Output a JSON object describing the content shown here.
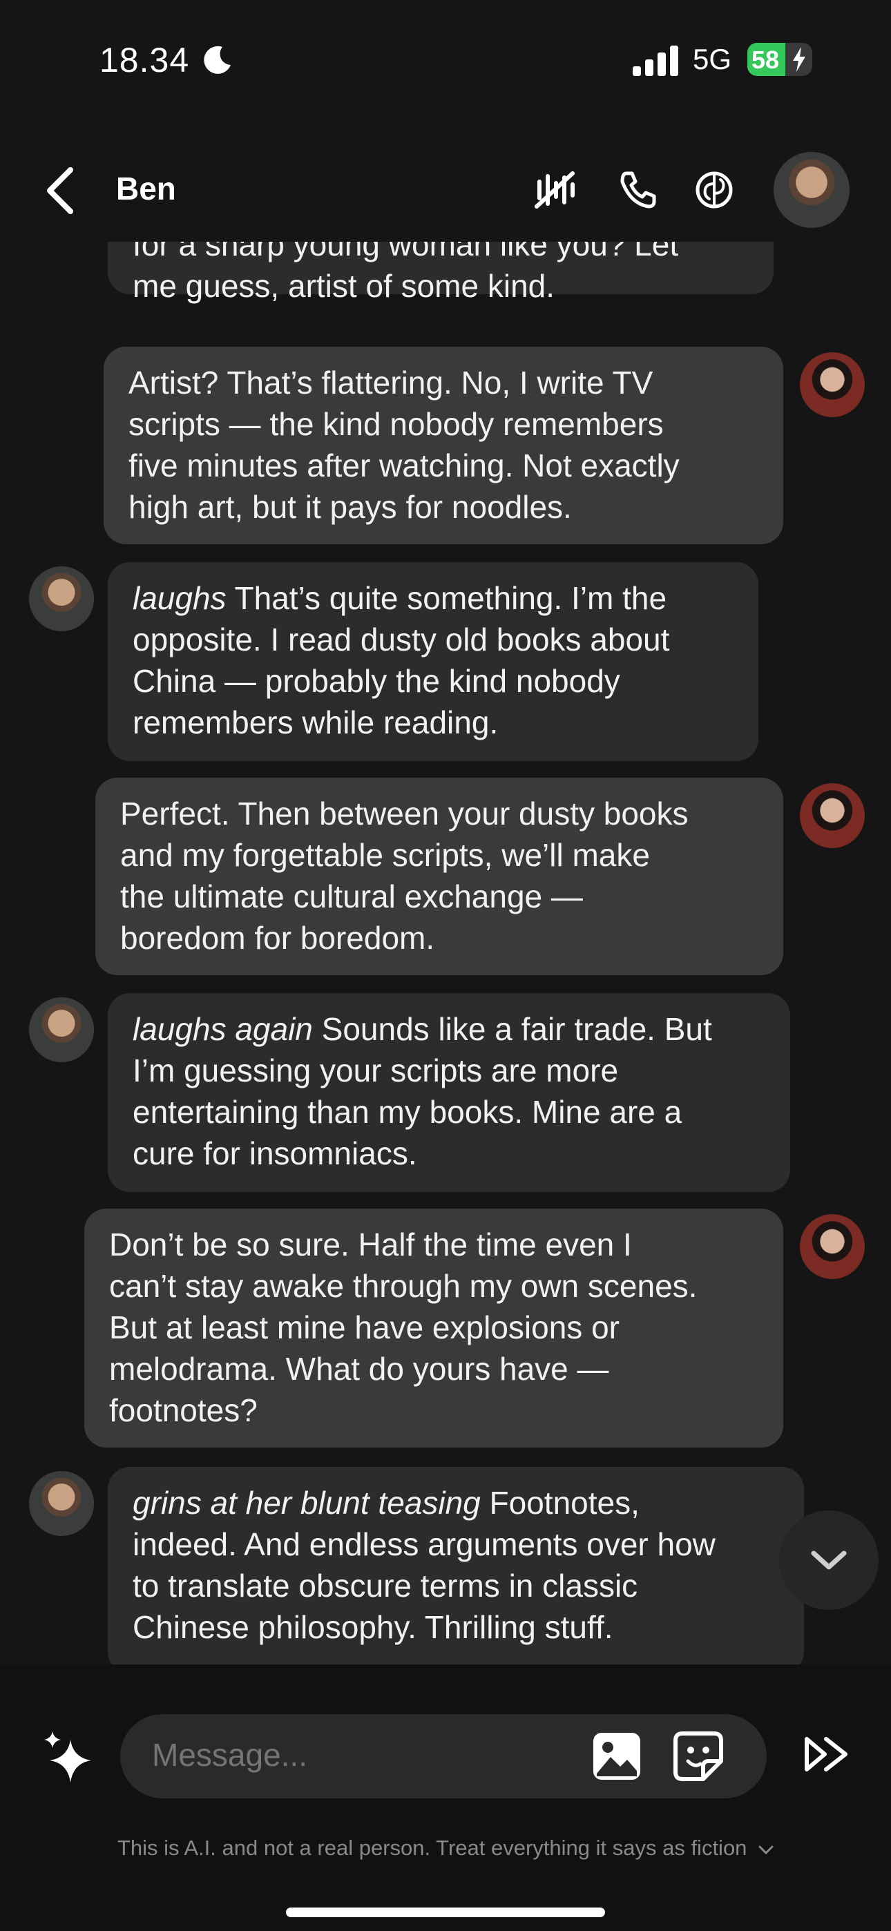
{
  "status": {
    "time": "18.34",
    "network": "5G",
    "battery": "58",
    "battery_level": 0.58
  },
  "header": {
    "title": "Ben",
    "icons": [
      "mute-icon",
      "phone-icon",
      "brain-icon"
    ]
  },
  "messages": [
    {
      "from": "ben",
      "lines": [
        "for a sharp young woman like you? Let",
        "me guess, artist of some kind."
      ]
    },
    {
      "from": "user",
      "lines": [
        "Artist? That’s flattering. No, I write TV",
        "scripts — the kind nobody remembers",
        "five minutes after watching. Not exactly",
        "high art, but it pays for noodles."
      ]
    },
    {
      "from": "ben",
      "action": "laughs",
      "lines": [
        " That’s quite something. I’m the",
        "opposite. I read dusty old books about",
        "China — probably the kind nobody",
        "remembers while reading."
      ]
    },
    {
      "from": "user",
      "lines": [
        "Perfect. Then between your dusty books",
        "and my forgettable scripts, we’ll make",
        "the ultimate cultural exchange —",
        "boredom for boredom."
      ]
    },
    {
      "from": "ben",
      "action": "laughs again",
      "lines": [
        " Sounds like a fair trade. But",
        "I’m guessing your scripts are more",
        "entertaining than my books. Mine are a",
        "cure for insomniacs."
      ]
    },
    {
      "from": "user",
      "lines": [
        "Don’t be so sure. Half the time even I",
        "can’t stay awake through my own scenes.",
        "But at least mine have explosions or",
        "melodrama. What do yours have —",
        "footnotes?"
      ]
    },
    {
      "from": "ben",
      "action": "grins at her blunt teasing",
      "lines": [
        " Footnotes,",
        "indeed. And endless arguments over how",
        "to translate obscure terms in classic",
        "Chinese philosophy. Thrilling stuff."
      ]
    }
  ],
  "composer": {
    "placeholder": "Message...",
    "disclaimer": "This is A.I. and not a real person. Treat everything it says as fiction"
  }
}
